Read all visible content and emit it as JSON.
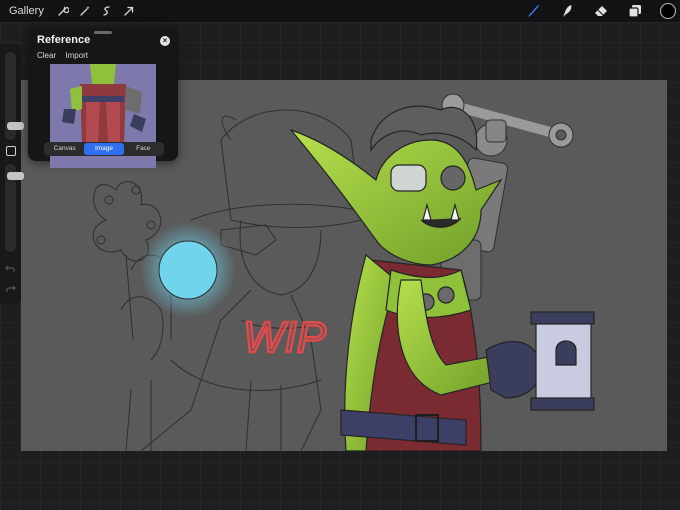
{
  "topbar": {
    "gallery_label": "Gallery",
    "left_tools": [
      "wrench-icon",
      "magic-wand-icon",
      "selection-icon",
      "transform-arrow-icon"
    ],
    "right_tools": [
      "brush-icon",
      "smudge-icon",
      "eraser-icon",
      "layers-icon"
    ],
    "active_tool": "brush-icon",
    "current_color": "#000000"
  },
  "reference_panel": {
    "title": "Reference",
    "close_glyph": "×",
    "actions": {
      "clear_label": "Clear",
      "import_label": "Import"
    },
    "tabs": [
      {
        "label": "Canvas",
        "active": false
      },
      {
        "label": "Image",
        "active": true
      },
      {
        "label": "Face",
        "active": false
      }
    ]
  },
  "sidebar": {
    "brush_size_level": 0.65,
    "opacity_level": 0.4
  },
  "canvas": {
    "annotation": "WIP"
  },
  "colors": {
    "accent": "#2f6ff0",
    "canvas_bg": "#5a5a5a",
    "goblin_skin": "#8fc23a",
    "glow_orb": "#6fd6ee",
    "wip_text": "#e04a4a"
  }
}
